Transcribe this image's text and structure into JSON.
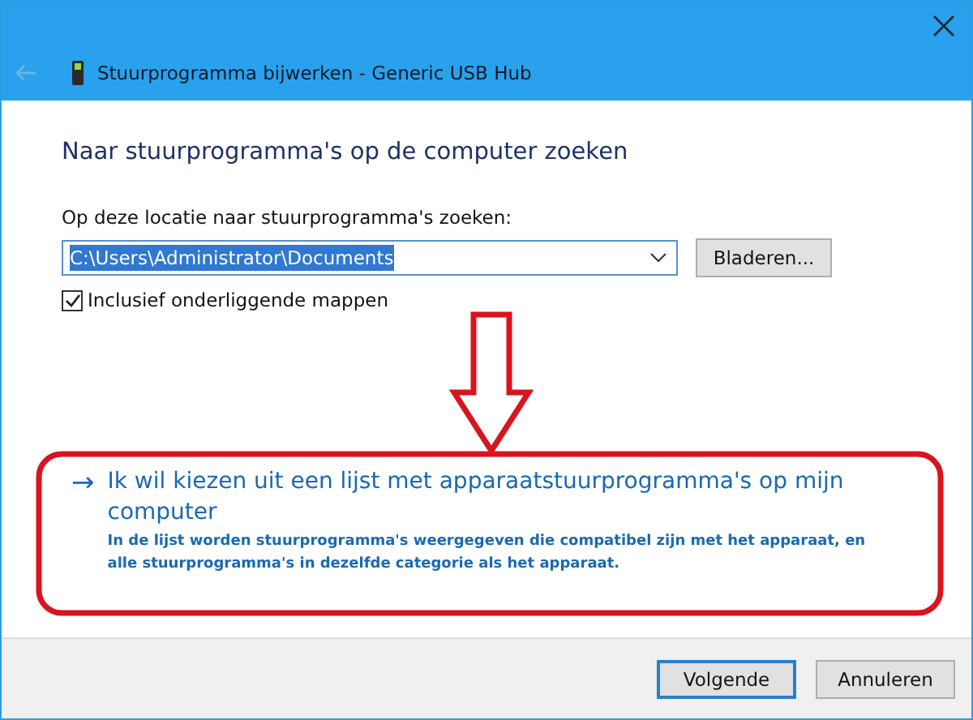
{
  "window": {
    "title": "Stuurprogramma bijwerken - Generic USB Hub",
    "back_disabled": true
  },
  "heading": "Naar stuurprogramma's op de computer zoeken",
  "location": {
    "label": "Op deze locatie naar stuurprogramma's zoeken:",
    "value": "C:\\Users\\Administrator\\Documents",
    "value_selected": true,
    "browse_button": "Bladeren..."
  },
  "subfolders": {
    "label": "Inclusief onderliggende mappen",
    "checked": true
  },
  "option": {
    "arrow": "→",
    "title": "Ik wil kiezen uit een lijst met apparaatstuurprogramma's op mijn computer",
    "description": "In de lijst worden stuurprogramma's weergegeven die compatibel zijn met het apparaat, en alle stuurprogramma's in dezelfde categorie als het apparaat."
  },
  "annotations": [
    {
      "kind": "arrow"
    },
    {
      "kind": "frame"
    }
  ],
  "buttons": [
    {
      "label": "Volgende",
      "default": true
    },
    {
      "label": "Annuleren",
      "default": false
    }
  ]
}
